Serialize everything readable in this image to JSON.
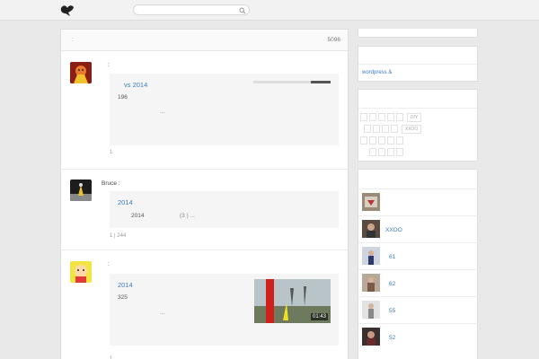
{
  "header": {
    "logo_icon": "bird-logo-icon",
    "search_placeholder": ""
  },
  "main": {
    "head_dot": ":",
    "head_count": "5096",
    "posts": [
      {
        "user": ":",
        "title": "vs 2014",
        "number": "196",
        "ellipsis": "...",
        "meta": "1",
        "has_progress": true
      },
      {
        "user": "Bruce :",
        "title": "2014",
        "number": "2014",
        "tail": "(3 ) ...",
        "meta": "1 | 244"
      },
      {
        "user": ":",
        "title": "2014",
        "number": "325",
        "ellipsis": "...",
        "meta": "1",
        "video_duration": "01:43"
      }
    ]
  },
  "sidebar": {
    "link_text": "wordpress &",
    "keyboard_labels": [
      "DIY",
      "XXOO"
    ],
    "videos": [
      {
        "label": ""
      },
      {
        "label": "XXOO"
      },
      {
        "label": "61"
      },
      {
        "label": "62"
      },
      {
        "label": "55"
      },
      {
        "label": "52"
      }
    ]
  },
  "colors": {
    "link": "#3b7bc0",
    "background": "#e9e9e9"
  }
}
